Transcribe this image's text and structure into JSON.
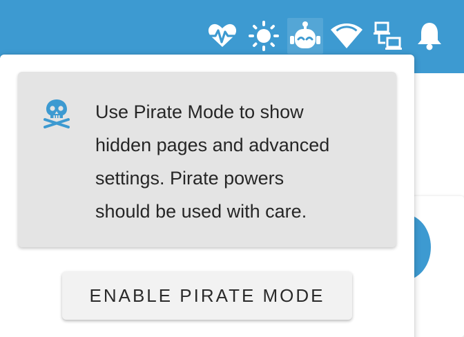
{
  "header": {
    "background_color": "#3d9ad1",
    "status_icons": [
      {
        "icon": "heartbeat-icon",
        "active": false
      },
      {
        "icon": "brightness-icon",
        "active": false
      },
      {
        "icon": "robot-icon",
        "active": true
      },
      {
        "icon": "wifi-icon",
        "active": false
      },
      {
        "icon": "network-icon",
        "active": false
      },
      {
        "icon": "bell-icon",
        "active": false
      }
    ]
  },
  "popover": {
    "notice": {
      "icon": "skull-crossbones-icon",
      "icon_color": "#3d9ad1",
      "lines": [
        "Use Pirate Mode to show",
        "hidden pages and advanced",
        "settings. Pirate powers",
        "should be used with care."
      ]
    },
    "enable_button_label": "ENABLE PIRATE MODE"
  }
}
